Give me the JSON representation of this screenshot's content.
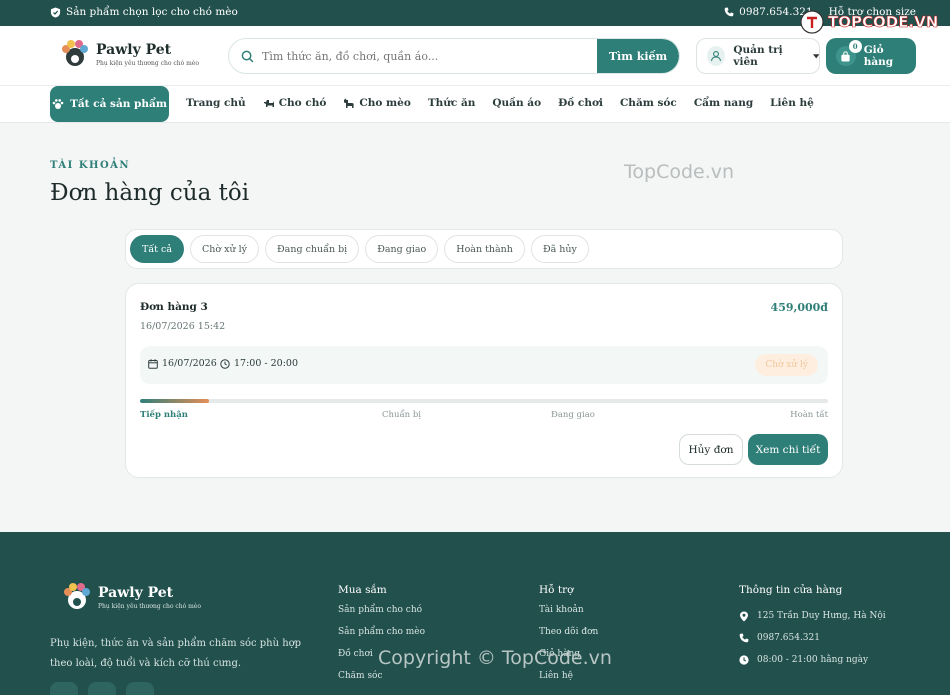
{
  "topbar": {
    "promo": "Sản phẩm chọn lọc cho chó mèo",
    "phone": "0987.654.321",
    "support": "Hỗ trợ chọn size"
  },
  "header": {
    "brand_name": "Pawly Pet",
    "brand_tagline": "Phụ kiện yêu thương cho chó mèo",
    "search_placeholder": "Tìm thức ăn, đồ chơi, quần áo...",
    "search_button": "Tìm kiếm",
    "account_label": "Quản trị viên",
    "cart_label": "Giỏ hàng",
    "cart_count": "0"
  },
  "nav": {
    "all_products": "Tất cả sản phẩm",
    "items": [
      "Trang chủ",
      "Cho chó",
      "Cho mèo",
      "Thức ăn",
      "Quần áo",
      "Đồ chơi",
      "Chăm sóc",
      "Cẩm nang",
      "Liên hệ"
    ]
  },
  "page": {
    "eyebrow": "TÀI KHOẢN",
    "title": "Đơn hàng của tôi"
  },
  "filters": [
    "Tất cả",
    "Chờ xử lý",
    "Đang chuẩn bị",
    "Đang giao",
    "Hoàn thành",
    "Đã hủy"
  ],
  "order": {
    "title": "Đơn hàng 3",
    "created": "16/07/2026 15:42",
    "total": "459,000đ",
    "delivery_date": "16/07/2026",
    "delivery_time": "17:00 - 20:00",
    "status": "Chờ xử lý",
    "progress": 0.1,
    "steps": [
      "Tiếp nhận",
      "Chuẩn bị",
      "Đang giao",
      "Hoàn tất"
    ],
    "cancel_label": "Hủy đơn",
    "detail_label": "Xem chi tiết"
  },
  "footer": {
    "brand_name": "Pawly Pet",
    "brand_tagline": "Phụ kiện yêu thương cho chó mèo",
    "description": "Phụ kiện, thức ăn và sản phẩm chăm sóc phù hợp theo loài, độ tuổi và kích cỡ thú cưng.",
    "shop_title": "Mua sắm",
    "shop_links": [
      "Sản phẩm cho chó",
      "Sản phẩm cho mèo",
      "Đồ chơi",
      "Chăm sóc"
    ],
    "help_title": "Hỗ trợ",
    "help_links": [
      "Tài khoản",
      "Theo dõi đơn",
      "Giỏ hàng",
      "Liên hệ"
    ],
    "info_title": "Thông tin cửa hàng",
    "address": "125 Trần Duy Hưng, Hà Nội",
    "phone": "0987.654.321",
    "hours": "08:00 - 21:00 hằng ngày"
  },
  "watermarks": {
    "brand": "TOPCODE.VN",
    "center": "TopCode.vn",
    "footer": "Copyright © TopCode.vn"
  },
  "colors": {
    "primary": "#2f7f79",
    "dark": "#22504d",
    "accent": "#e58e57"
  }
}
